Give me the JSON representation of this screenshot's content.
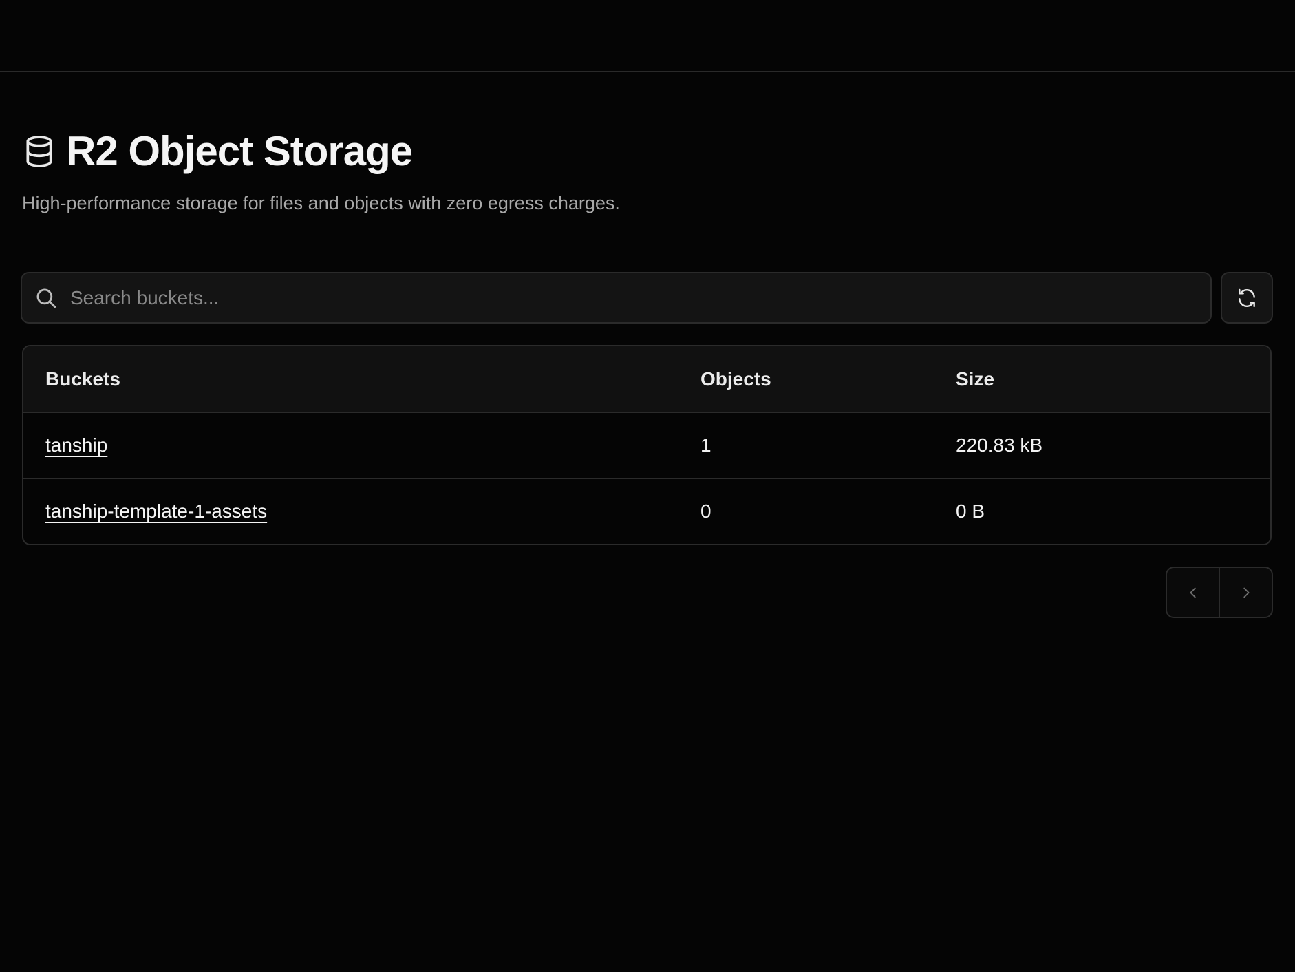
{
  "header": {
    "title": "R2 Object Storage",
    "subtitle": "High-performance storage for files and objects with zero egress charges.",
    "icon": "database-icon"
  },
  "search": {
    "placeholder": "Search buckets...",
    "value": ""
  },
  "toolbar": {
    "refresh_icon": "refresh-icon"
  },
  "table": {
    "columns": [
      "Buckets",
      "Objects",
      "Size"
    ],
    "rows": [
      {
        "name": "tanship",
        "objects": "1",
        "size": "220.83 kB"
      },
      {
        "name": "tanship-template-1-assets",
        "objects": "0",
        "size": "0 B"
      }
    ]
  },
  "pagination": {
    "prev_icon": "chevron-left-icon",
    "next_icon": "chevron-right-icon"
  },
  "colors": {
    "background": "#050505",
    "border": "#2b2b2b",
    "muted_text": "#a9a9a9"
  }
}
